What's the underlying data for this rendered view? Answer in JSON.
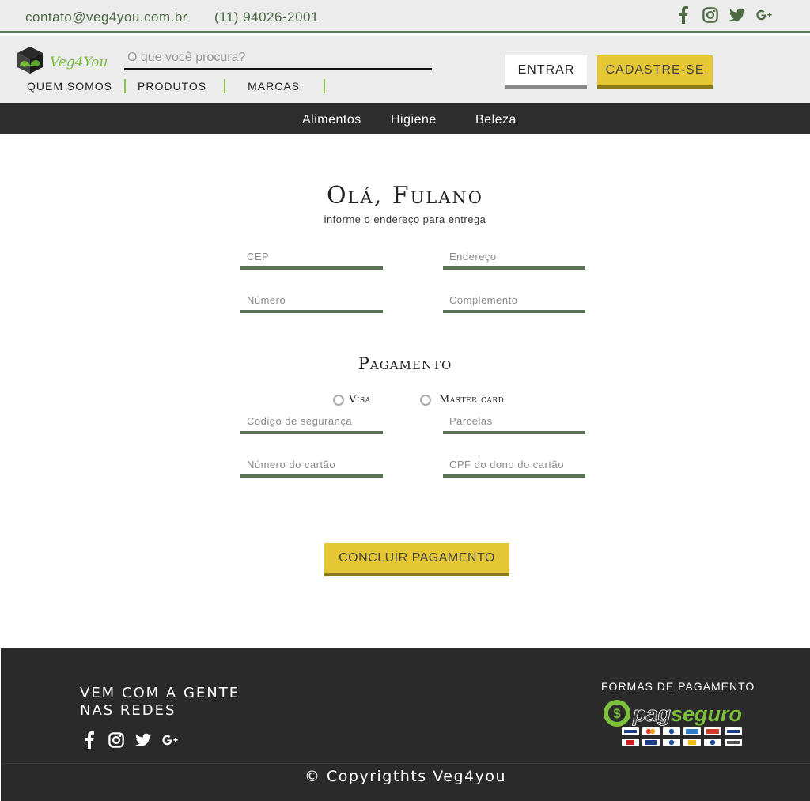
{
  "topbar": {
    "email": "contato@veg4you.com.br",
    "phone": "(11) 94026-2001",
    "social_icons": [
      "facebook-icon",
      "instagram-icon",
      "twitter-icon",
      "google-plus-icon"
    ]
  },
  "header": {
    "brand": "Veg4You",
    "search_placeholder": "O que você procura?",
    "nav": [
      "QUEM SOMOS",
      "PRODUTOS",
      "MARCAS"
    ],
    "login_label": "ENTRAR",
    "signup_label": "CADASTRE-SE"
  },
  "categories": [
    "Alimentos",
    "Higiene",
    "Beleza"
  ],
  "checkout": {
    "greeting": "Olá, Fulano",
    "subtitle": "informe o endereço para entrega",
    "address_fields": {
      "cep": "CEP",
      "endereco": "Endereço",
      "numero": "Número",
      "complemento": "Complemento"
    },
    "payment_title": "Pagamento",
    "card_options": [
      "Visa",
      "Master card"
    ],
    "payment_fields": {
      "codigo": "Codigo de segurança",
      "parcelas": "Parcelas",
      "numero_cartao": "Número do cartão",
      "cpf": "CPF do dono do cartão"
    },
    "submit_label": "CONCLUIR PAGAMENTO"
  },
  "footer": {
    "social_line1": "VEM COM A GENTE",
    "social_line2": "NAS REDES",
    "payment_methods_title": "FORMAS DE PAGAMENTO",
    "payment_logo_text_1": "pag",
    "payment_logo_text_2": "seguro",
    "copyright": "© Copyrigthts Veg4you"
  },
  "colors": {
    "accent_green": "#5c7a52",
    "accent_yellow": "#e5c736",
    "dark": "#2a2a2a"
  }
}
